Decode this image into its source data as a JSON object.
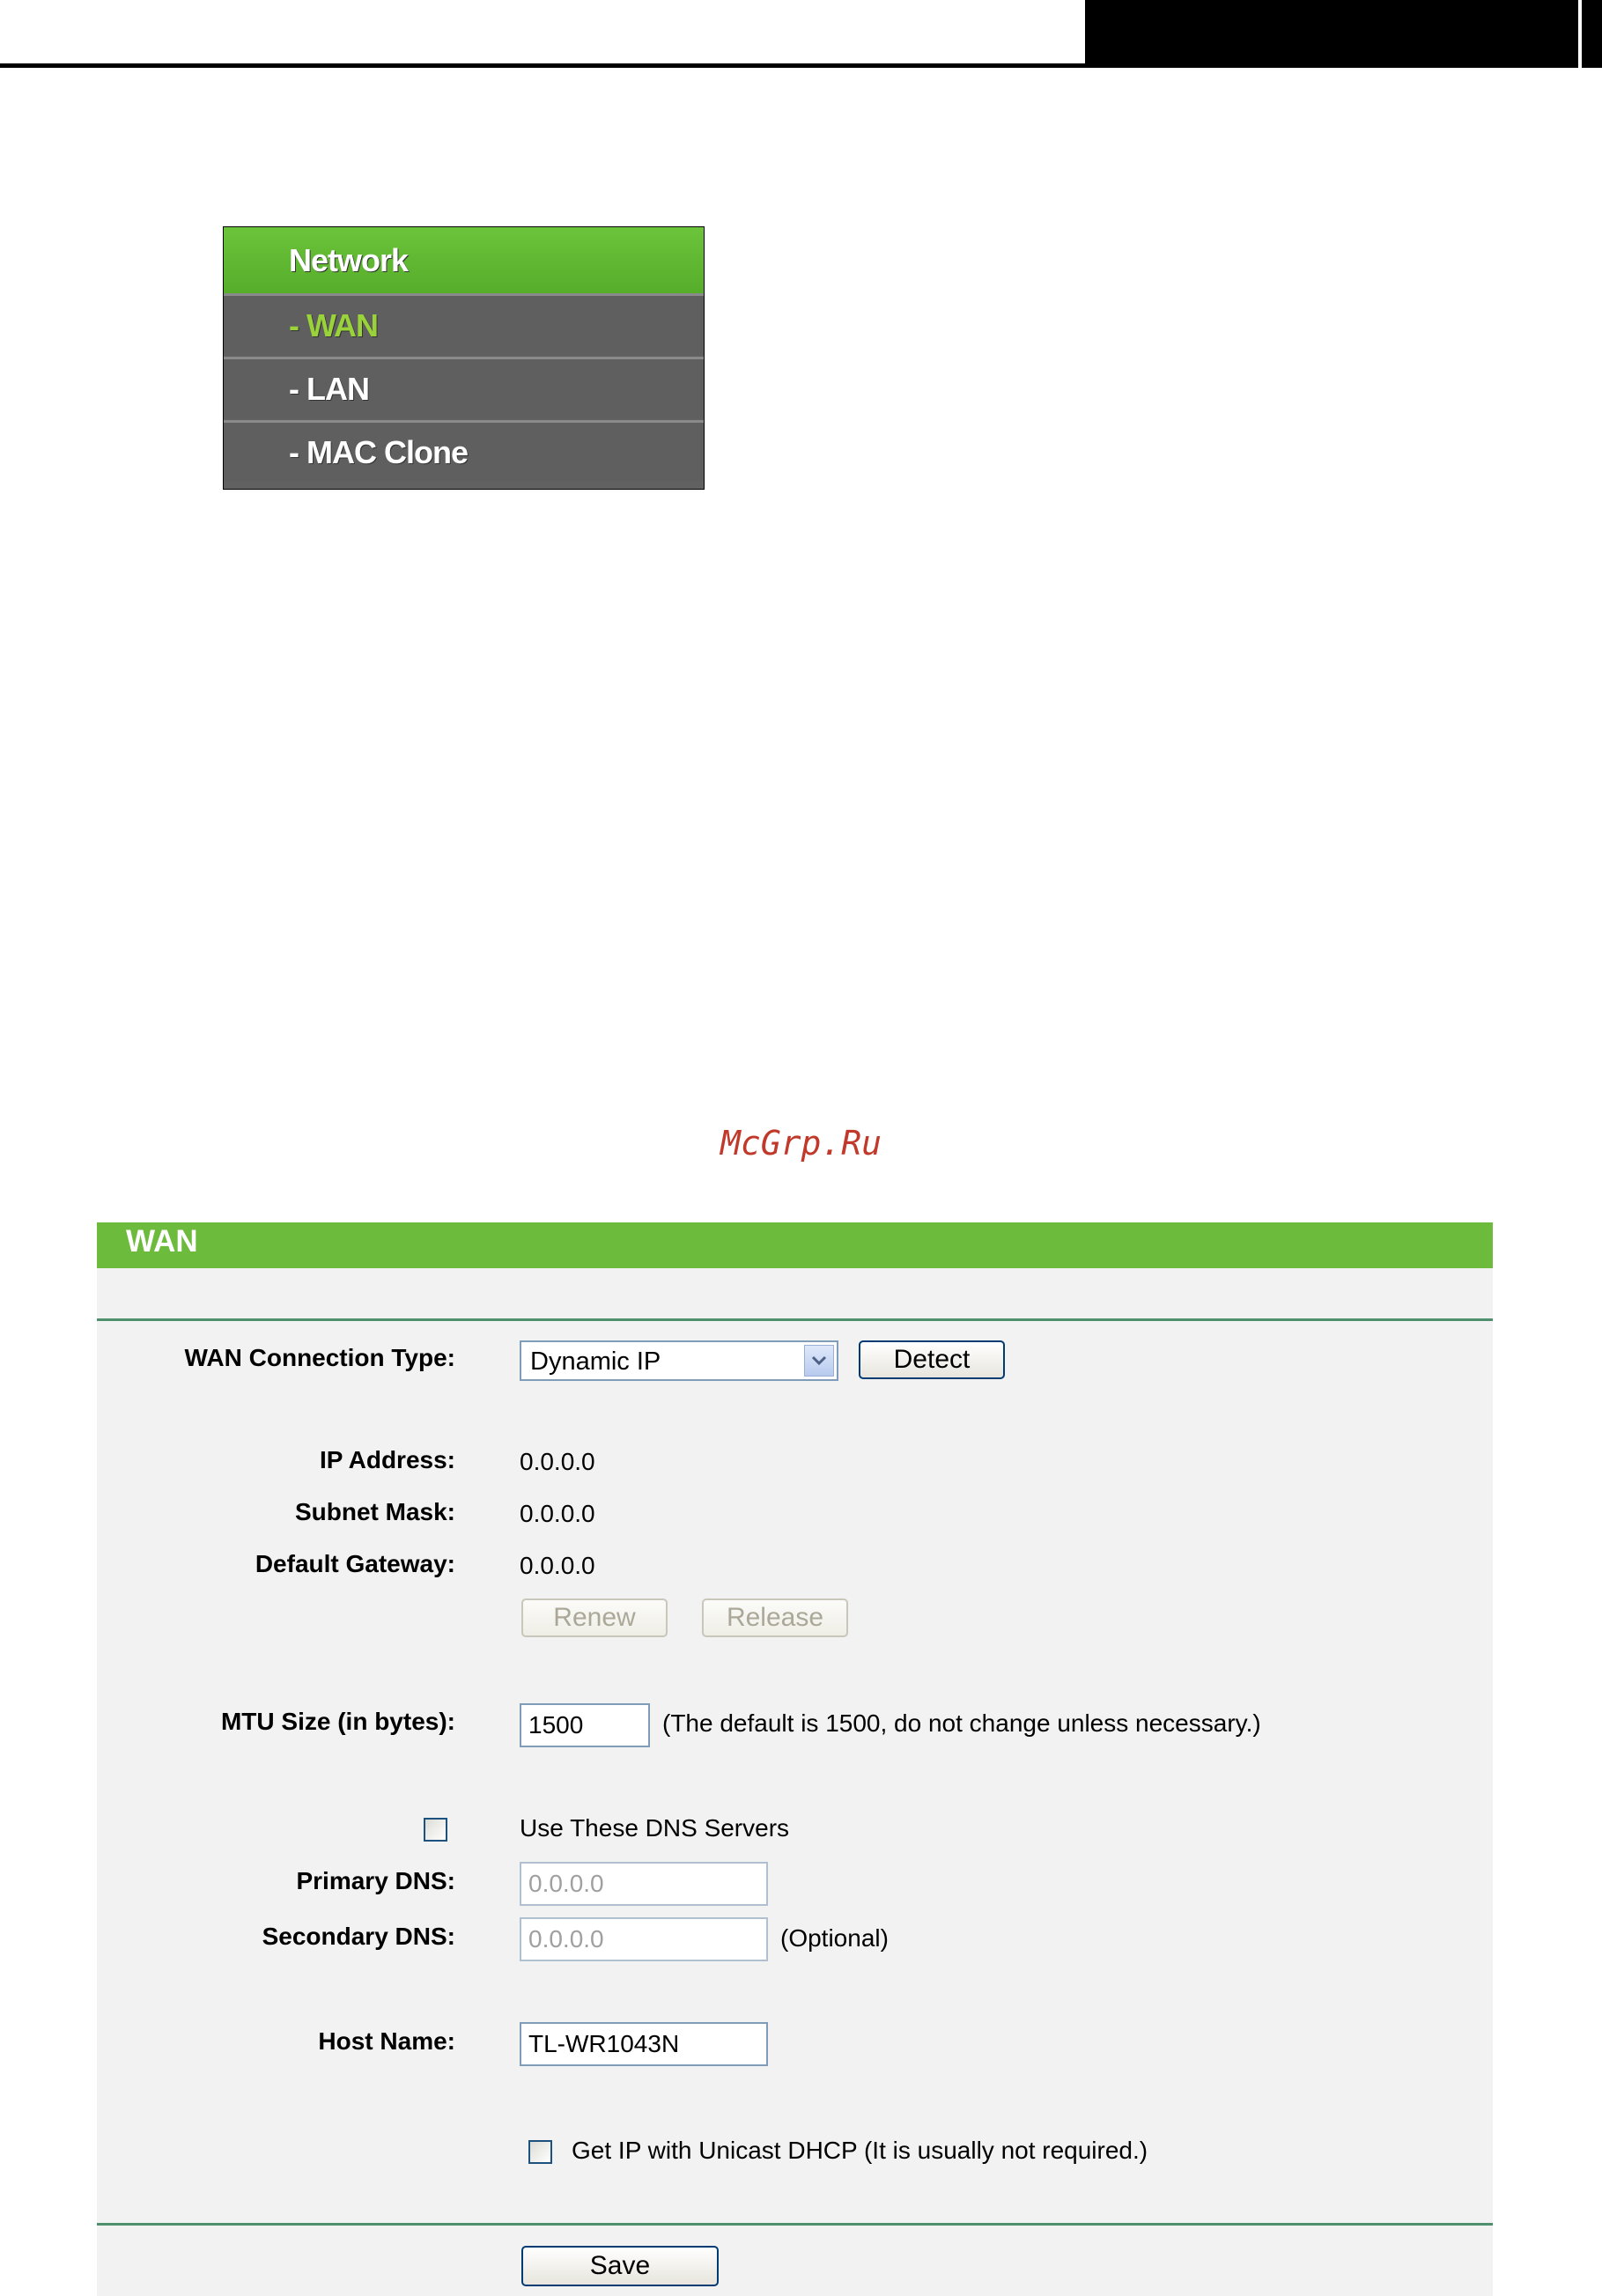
{
  "menu": {
    "title": "Network",
    "items": [
      {
        "label": "- WAN",
        "active": true
      },
      {
        "label": "- LAN",
        "active": false
      },
      {
        "label": "- MAC Clone",
        "active": false
      }
    ]
  },
  "watermark": "McGrp.Ru",
  "wan": {
    "title": "WAN",
    "connection_type": {
      "label": "WAN Connection Type:",
      "value": "Dynamic IP",
      "detect_label": "Detect"
    },
    "ip_address": {
      "label": "IP Address:",
      "value": "0.0.0.0"
    },
    "subnet_mask": {
      "label": "Subnet Mask:",
      "value": "0.0.0.0"
    },
    "default_gateway": {
      "label": "Default Gateway:",
      "value": "0.0.0.0"
    },
    "renew_label": "Renew",
    "release_label": "Release",
    "mtu": {
      "label": "MTU Size (in bytes):",
      "value": "1500",
      "note": "(The default is 1500, do not change unless necessary.)"
    },
    "dns": {
      "use_label": "Use These DNS Servers",
      "checked": false,
      "primary_label": "Primary DNS:",
      "primary_value": "0.0.0.0",
      "secondary_label": "Secondary DNS:",
      "secondary_value": "0.0.0.0",
      "optional_note": "(Optional)"
    },
    "host_name": {
      "label": "Host Name:",
      "value": "TL-WR1043N"
    },
    "unicast": {
      "label": "Get IP with Unicast DHCP (It is usually not required.)",
      "checked": false
    },
    "save_label": "Save"
  },
  "colors": {
    "menu_green": "#6cc43b",
    "menu_active_text": "#9ad23a",
    "menu_gray": "#616161",
    "panel_header": "#6cbb3c",
    "watermark": "#c0392b"
  }
}
